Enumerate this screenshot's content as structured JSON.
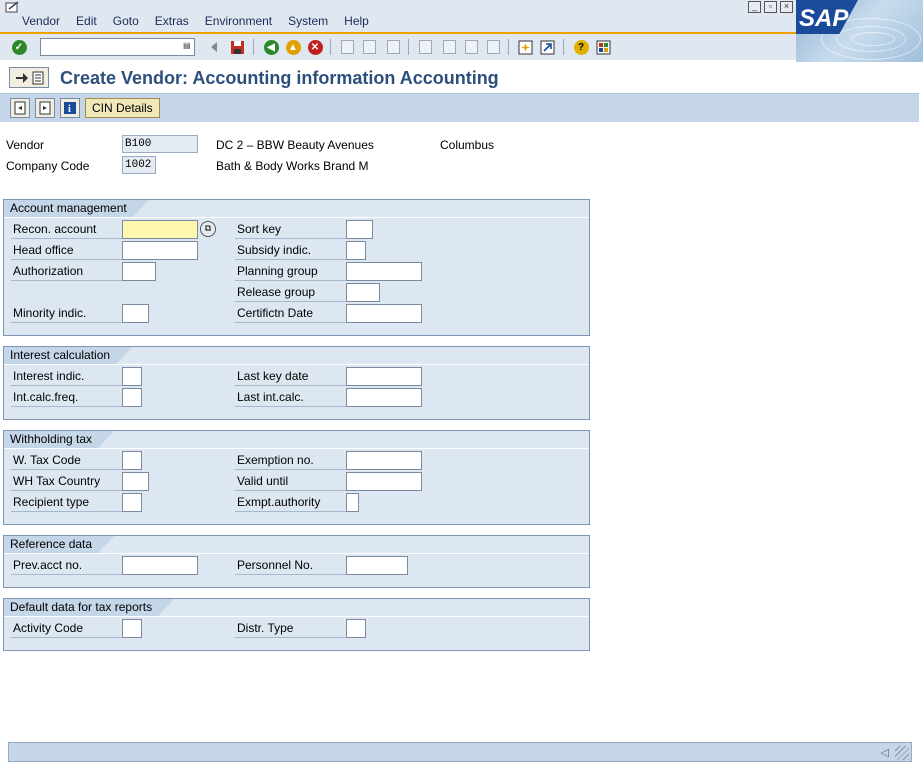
{
  "menubar": {
    "items": [
      "Vendor",
      "Edit",
      "Goto",
      "Extras",
      "Environment",
      "System",
      "Help"
    ]
  },
  "toolbar": {
    "command_value": ""
  },
  "title": "Create Vendor: Accounting information Accounting",
  "appbar": {
    "cin_label": "CIN Details"
  },
  "header": {
    "vendor_label": "Vendor",
    "vendor_value": "B100",
    "vendor_name": "DC 2 – BBW Beauty Avenues",
    "vendor_city": "Columbus",
    "company_label": "Company Code",
    "company_value": "1002",
    "company_name": "Bath & Body Works Brand M"
  },
  "groups": {
    "account_management": {
      "title": "Account management",
      "recon_account": "Recon. account",
      "head_office": "Head office",
      "authorization": "Authorization",
      "minority_indic": "Minority indic.",
      "sort_key": "Sort key",
      "subsidy_indic": "Subsidy indic.",
      "planning_group": "Planning group",
      "release_group": "Release group",
      "certifictn_date": "Certifictn Date"
    },
    "interest_calculation": {
      "title": "Interest calculation",
      "interest_indic": "Interest indic.",
      "int_calc_freq": "Int.calc.freq.",
      "last_key_date": "Last key date",
      "last_int_calc": "Last int.calc."
    },
    "withholding_tax": {
      "title": "Withholding tax",
      "w_tax_code": "W. Tax Code",
      "wh_tax_country": "WH Tax Country",
      "recipient_type": "Recipient type",
      "exemption_no": "Exemption no.",
      "valid_until": "Valid  until",
      "exmpt_authority": "Exmpt.authority"
    },
    "reference_data": {
      "title": "Reference data",
      "prev_acct_no": "Prev.acct no.",
      "personnel_no": "Personnel No."
    },
    "default_tax": {
      "title": "Default data for tax reports",
      "activity_code": "Activity Code",
      "distr_type": "Distr. Type"
    }
  },
  "colors": {
    "group_bg": "#dde7f1",
    "title_color": "#2d4f7c",
    "required_field": "#fff6b0",
    "accent_line": "#f0a000"
  }
}
